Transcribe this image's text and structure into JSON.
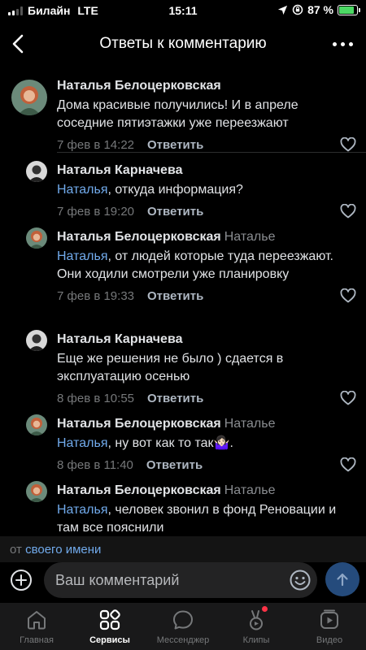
{
  "status_bar": {
    "carrier": "Билайн",
    "network": "LTE",
    "time": "15:11",
    "battery_text": "87 %",
    "battery_level": 0.87
  },
  "header": {
    "title": "Ответы к комментарию"
  },
  "comments": [
    {
      "author": "Наталья Белоцерковская",
      "reply_to": "",
      "mention": "",
      "text": "Дома красивые получились! И в апреле соседние пятиэтажки уже переезжают",
      "date": "7 фев в 14:22",
      "reply_label": "Ответить",
      "avatar": "redhead"
    },
    {
      "author": "Наталья Карначева",
      "reply_to": "",
      "mention": "Наталья",
      "text": ", откуда информация?",
      "date": "7 фев в 19:20",
      "reply_label": "Ответить",
      "avatar": "bw"
    },
    {
      "author": "Наталья Белоцерковская",
      "reply_to": "Наталье",
      "mention": "Наталья",
      "text": ", от людей которые туда переезжают. Они ходили смотрели уже планировку",
      "date": "7 фев в 19:33",
      "reply_label": "Ответить",
      "avatar": "redhead"
    },
    {
      "author": "Наталья Карначева",
      "reply_to": "",
      "mention": "",
      "text": "Еще же решения не было ) сдается в эксплуатацию осенью",
      "date": "8 фев в 10:55",
      "reply_label": "Ответить",
      "avatar": "bw"
    },
    {
      "author": "Наталья Белоцерковская",
      "reply_to": "Наталье",
      "mention": "Наталья",
      "text": ", ну вот как то так🤷🏻‍♀️.",
      "date": "8 фев в 11:40",
      "reply_label": "Ответить",
      "avatar": "redhead"
    },
    {
      "author": "Наталья Белоцерковская",
      "reply_to": "Наталье",
      "mention": "Наталья",
      "text": ", человек звонил в фонд Реновации и там все пояснили",
      "date": "",
      "reply_label": "",
      "avatar": "redhead"
    }
  ],
  "reply_banner": {
    "prefix": "от",
    "name": "своего имени"
  },
  "composer": {
    "placeholder": "Ваш комментарий"
  },
  "tabs": [
    {
      "label": "Главная",
      "icon": "home-icon",
      "active": false
    },
    {
      "label": "Сервисы",
      "icon": "services-icon",
      "active": true
    },
    {
      "label": "Мессенджер",
      "icon": "messenger-icon",
      "active": false
    },
    {
      "label": "Клипы",
      "icon": "clips-icon",
      "active": false
    },
    {
      "label": "Видео",
      "icon": "video-icon",
      "active": false
    }
  ],
  "colors": {
    "background": "#000000",
    "accent_link": "#71aaeb",
    "send_button": "#254b7c",
    "notification": "#ff3347"
  }
}
